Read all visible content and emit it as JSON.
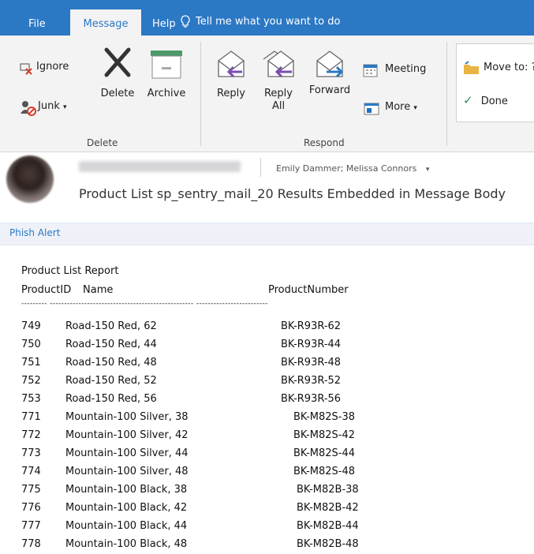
{
  "tabs": [
    {
      "label": "File"
    },
    {
      "label": "Message"
    },
    {
      "label": "Help"
    }
  ],
  "tell_me": "Tell me what you want to do",
  "ribbon": {
    "ignore": "Ignore",
    "junk": "Junk",
    "delete": "Delete",
    "archive": "Archive",
    "reply": "Reply",
    "reply_all_1": "Reply",
    "reply_all_2": "All",
    "forward": "Forward",
    "meeting": "Meeting",
    "more": "More",
    "move_to": "Move to: ?",
    "done": "Done",
    "group_delete": "Delete",
    "group_respond": "Respond"
  },
  "message": {
    "recipients": "Emily Dammer; Melissa Connors",
    "subject": "Product List sp_sentry_mail_20 Results Embedded in Message Body"
  },
  "phish_alert": "Phish Alert",
  "report": {
    "title": "Product List Report",
    "col_id": "ProductID",
    "col_name": "Name",
    "col_number": "ProductNumber",
    "separator": "--------- -------------------------------------------------- -------------------------",
    "rows": [
      {
        "id": "749",
        "name": "Road-150 Red, 62",
        "number": "BK-R93R-62"
      },
      {
        "id": "750",
        "name": "Road-150 Red, 44",
        "number": "BK-R93R-44"
      },
      {
        "id": "751",
        "name": "Road-150 Red, 48",
        "number": "BK-R93R-48"
      },
      {
        "id": "752",
        "name": "Road-150 Red, 52",
        "number": "BK-R93R-52"
      },
      {
        "id": "753",
        "name": "Road-150 Red, 56",
        "number": "BK-R93R-56"
      },
      {
        "id": "771",
        "name": "Mountain-100 Silver, 38",
        "number": "BK-M82S-38"
      },
      {
        "id": "772",
        "name": "Mountain-100 Silver, 42",
        "number": "BK-M82S-42"
      },
      {
        "id": "773",
        "name": "Mountain-100 Silver, 44",
        "number": "BK-M82S-44"
      },
      {
        "id": "774",
        "name": "Mountain-100 Silver, 48",
        "number": "BK-M82S-48"
      },
      {
        "id": "775",
        "name": "Mountain-100 Black, 38",
        "number": "BK-M82B-38"
      },
      {
        "id": "776",
        "name": "Mountain-100 Black, 42",
        "number": "BK-M82B-42"
      },
      {
        "id": "777",
        "name": "Mountain-100 Black, 44",
        "number": "BK-M82B-44"
      },
      {
        "id": "778",
        "name": "Mountain-100 Black, 48",
        "number": "BK-M82B-48"
      }
    ]
  },
  "colors": {
    "accent": "#2b78c5",
    "ribbon": "#f3f3f3"
  }
}
